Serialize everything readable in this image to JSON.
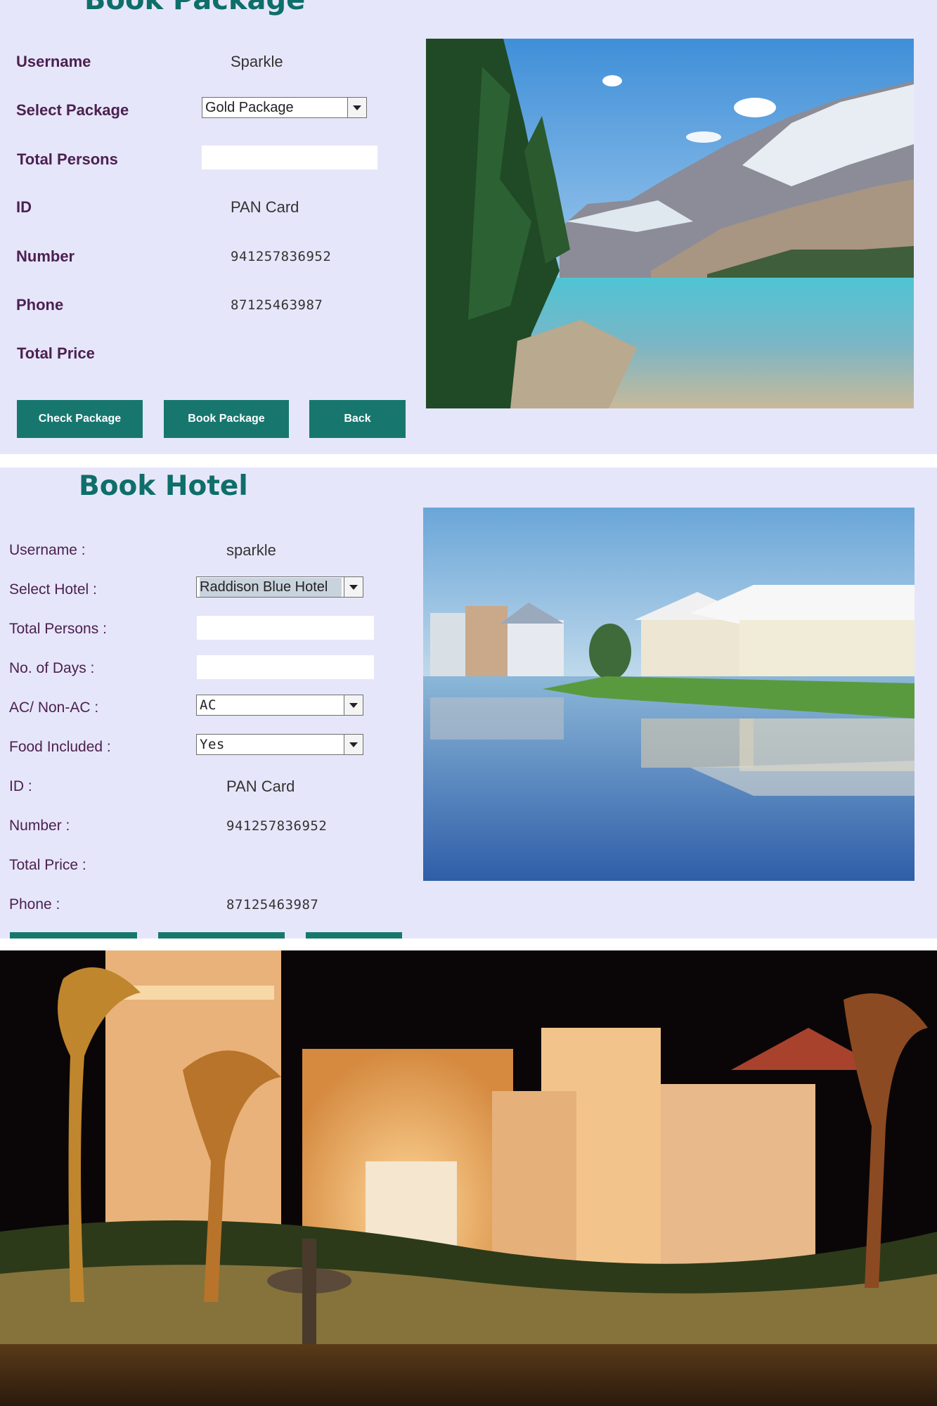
{
  "package_form": {
    "title": "Book Package",
    "rows": [
      {
        "label": "Username",
        "value": "Sparkle"
      },
      {
        "label": "Select Package",
        "value": "Gold Package"
      },
      {
        "label": "Total Persons",
        "value": ""
      },
      {
        "label": "ID",
        "value": "PAN Card"
      },
      {
        "label": "Number",
        "value": "941257836952"
      },
      {
        "label": "Phone",
        "value": "87125463987"
      },
      {
        "label": "Total Price",
        "value": ""
      }
    ],
    "buttons": {
      "check": "Check Package",
      "book": "Book Package",
      "back": "Back"
    },
    "image": "mountain-lake-photo"
  },
  "hotel_form": {
    "title": "Book Hotel",
    "rows": [
      {
        "label": "Username :",
        "value": "sparkle"
      },
      {
        "label": "Select Hotel :",
        "value": "Raddison Blue Hotel"
      },
      {
        "label": "Total Persons :",
        "value": ""
      },
      {
        "label": "No. of Days :",
        "value": ""
      },
      {
        "label": "AC/ Non-AC :",
        "value": "AC"
      },
      {
        "label": "Food Included :",
        "value": "Yes"
      },
      {
        "label": "ID :",
        "value": "PAN Card"
      },
      {
        "label": "Number :",
        "value": "941257836952"
      },
      {
        "label": "Total Price :",
        "value": ""
      },
      {
        "label": "Phone :",
        "value": "87125463987"
      }
    ],
    "image": "lakeside-villas-photo"
  },
  "bottom_image": "illuminated-hotel-night-photo",
  "colors": {
    "panel_bg": "#e6e6fa",
    "accent": "#17776f",
    "title": "#0e6e6a",
    "label": "#4b2150"
  }
}
